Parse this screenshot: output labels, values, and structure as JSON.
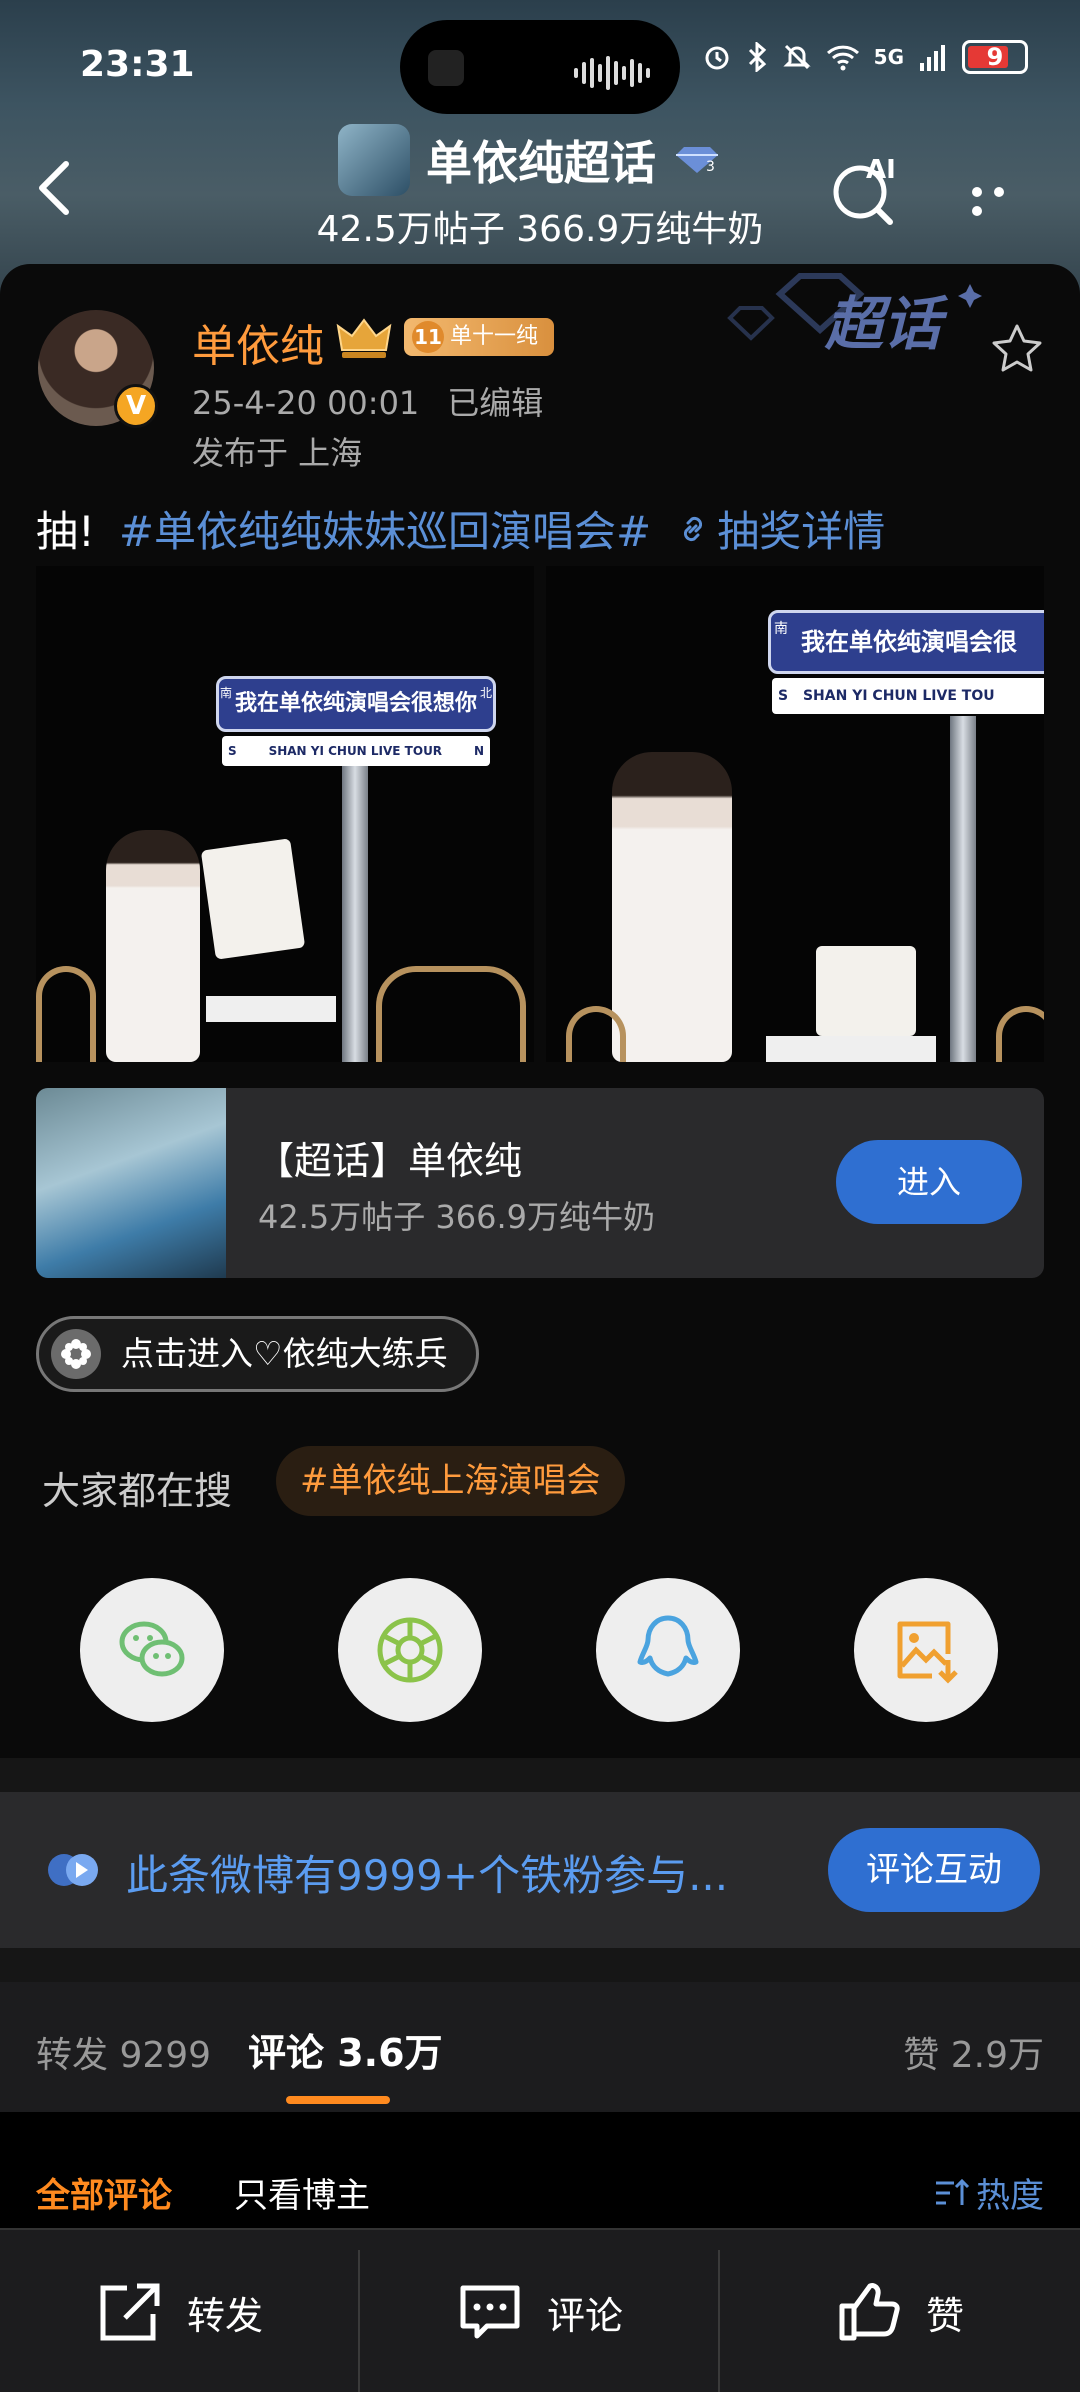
{
  "status_bar": {
    "time": "23:31",
    "network": "5G",
    "battery": "9",
    "icons": [
      "alarm-icon",
      "bluetooth-icon",
      "mute-icon",
      "wifi-icon",
      "signal-icon",
      "battery-icon"
    ]
  },
  "header": {
    "title": "单依纯超话",
    "subtitle": "42.5万帖子 366.9万纯牛奶",
    "ai_label": "AI"
  },
  "post": {
    "author": "单依纯",
    "fan_level": "11",
    "fan_badge": "单十一纯",
    "verified": "V",
    "date": "25-4-20 00:01",
    "edited": "已编辑",
    "location": "发布于 上海",
    "watermark": "超话",
    "text_prefix": "抽!",
    "hashtag": "#单依纯纯妹妹巡回演唱会#",
    "lottery_link": "抽奖详情",
    "photos": [
      {
        "sign_text": "我在单依纯演唱会很想你",
        "sign_sub": "SHAN YI CHUN LIVE TOUR",
        "left_letter": "S",
        "right_letter": "N",
        "top_left": "南",
        "top_right": "北"
      },
      {
        "sign_text": "我在单依纯演唱会很",
        "sign_sub": "SHAN YI CHUN LIVE TOU",
        "left_letter": "S",
        "top_left": "南"
      }
    ]
  },
  "topic_card": {
    "name": "【超话】单依纯",
    "stats": "42.5万帖子 366.9万纯牛奶",
    "enter_label": "进入"
  },
  "tag_pill": "点击进入♡依纯大练兵",
  "search": {
    "label": "大家都在搜",
    "tag": "#单依纯上海演唱会"
  },
  "share": [
    "wechat-icon",
    "moments-icon",
    "qq-icon",
    "save-image-icon"
  ],
  "fans_bar": {
    "text": "此条微博有9999+个铁粉参与...",
    "button": "评论互动"
  },
  "tabs": {
    "repost": "转发 9299",
    "comment": "评论 3.6万",
    "like": "赞 2.9万"
  },
  "filters": {
    "all": "全部评论",
    "author_only": "只看博主",
    "sort": "热度"
  },
  "bottom_bar": {
    "repost": "转发",
    "comment": "评论",
    "like": "赞"
  },
  "colors": {
    "accent_orange": "#ff8a1f",
    "link_blue": "#5b8fd6",
    "button_blue": "#2f6fd1"
  }
}
